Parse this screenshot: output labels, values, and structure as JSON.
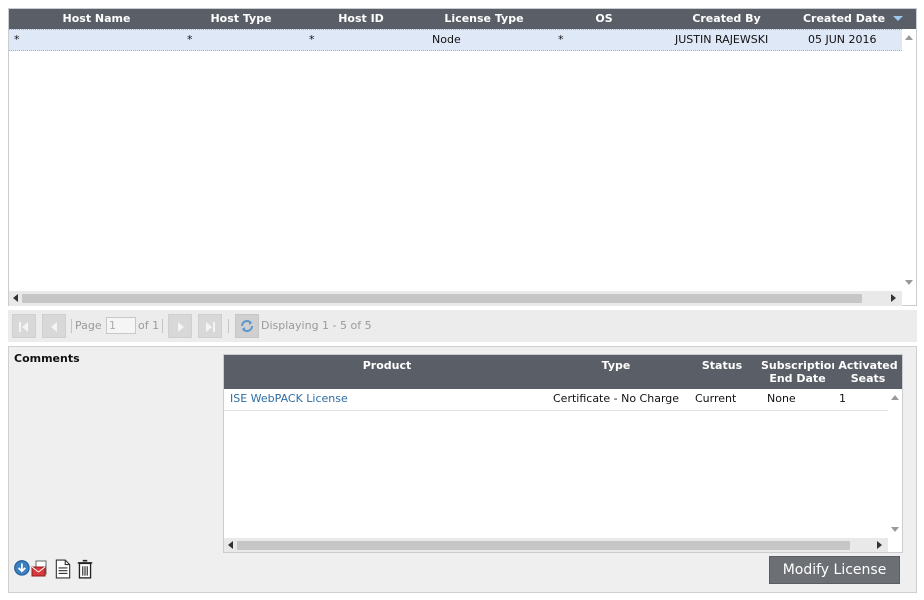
{
  "license_grid": {
    "columns": [
      "Host Name",
      "Host Type",
      "Host ID",
      "License Type",
      "OS",
      "Created By",
      "Created Date"
    ],
    "sorted_column": "Created Date",
    "sort_direction": "descending",
    "rows": [
      {
        "host_name": "*",
        "host_type": "*",
        "host_id": "*",
        "license_type": "Node",
        "os": "*",
        "created_by": "JUSTIN RAJEWSKI",
        "created_date": "05 JUN 2016"
      }
    ]
  },
  "pager": {
    "page_label": "Page",
    "page_value": "1",
    "of_label": "of 1",
    "displaying": "Displaying 1 - 5 of 5"
  },
  "comments": {
    "label": "Comments"
  },
  "product_grid": {
    "columns": {
      "product": "Product",
      "type": "Type",
      "status": "Status",
      "subscription_line1": "Subscription",
      "subscription_line2": "End Date",
      "activated_line1": "Activated",
      "activated_line2": "Seats"
    },
    "rows": [
      {
        "product": "ISE WebPACK License",
        "type": "Certificate - No Charge",
        "status": "Current",
        "subscription_end": "None",
        "activated_seats": "1"
      }
    ]
  },
  "actions": {
    "icons": [
      "download-icon",
      "email-pdf-icon",
      "document-icon",
      "trash-icon"
    ],
    "modify_label": "Modify License"
  },
  "colors": {
    "header_bg": "#5a5e66",
    "selected_row": "#dfe8f6",
    "link": "#2e6da4",
    "button_bg": "#6c6f74"
  }
}
